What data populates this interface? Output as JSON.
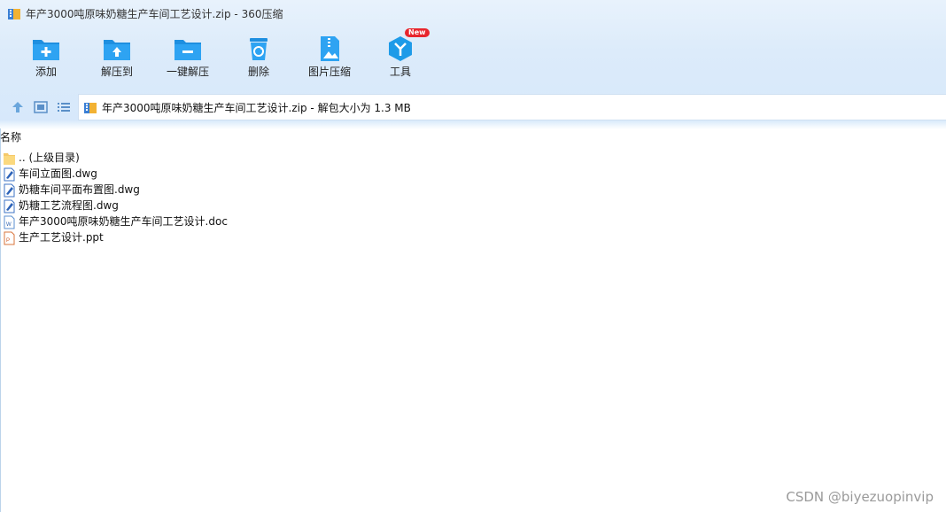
{
  "window": {
    "title": "年产3000吨原味奶糖生产车间工艺设计.zip - 360压缩"
  },
  "toolbar": {
    "add_label": "添加",
    "extract_to_label": "解压到",
    "one_click_extract_label": "一键解压",
    "delete_label": "删除",
    "image_compress_label": "图片压缩",
    "tools_label": "工具",
    "tools_badge": "New"
  },
  "address": {
    "text": "年产3000吨原味奶糖生产车间工艺设计.zip - 解包大小为 1.3 MB"
  },
  "list": {
    "column_name": "名称",
    "items": [
      {
        "name": ".. (上级目录)",
        "icon": "folder-icon"
      },
      {
        "name": "车间立面图.dwg",
        "icon": "dwg-file-icon"
      },
      {
        "name": "奶糖车间平面布置图.dwg",
        "icon": "dwg-file-icon"
      },
      {
        "name": "奶糖工艺流程图.dwg",
        "icon": "dwg-file-icon"
      },
      {
        "name": "年产3000吨原味奶糖生产车间工艺设计.doc",
        "icon": "doc-file-icon"
      },
      {
        "name": "生产工艺设计.ppt",
        "icon": "ppt-file-icon"
      }
    ]
  },
  "watermark": "CSDN @biyezuopinvip",
  "colors": {
    "accent_blue": "#1e9be8",
    "badge_red": "#e8262d",
    "chrome_bg": "#dcebfa"
  }
}
